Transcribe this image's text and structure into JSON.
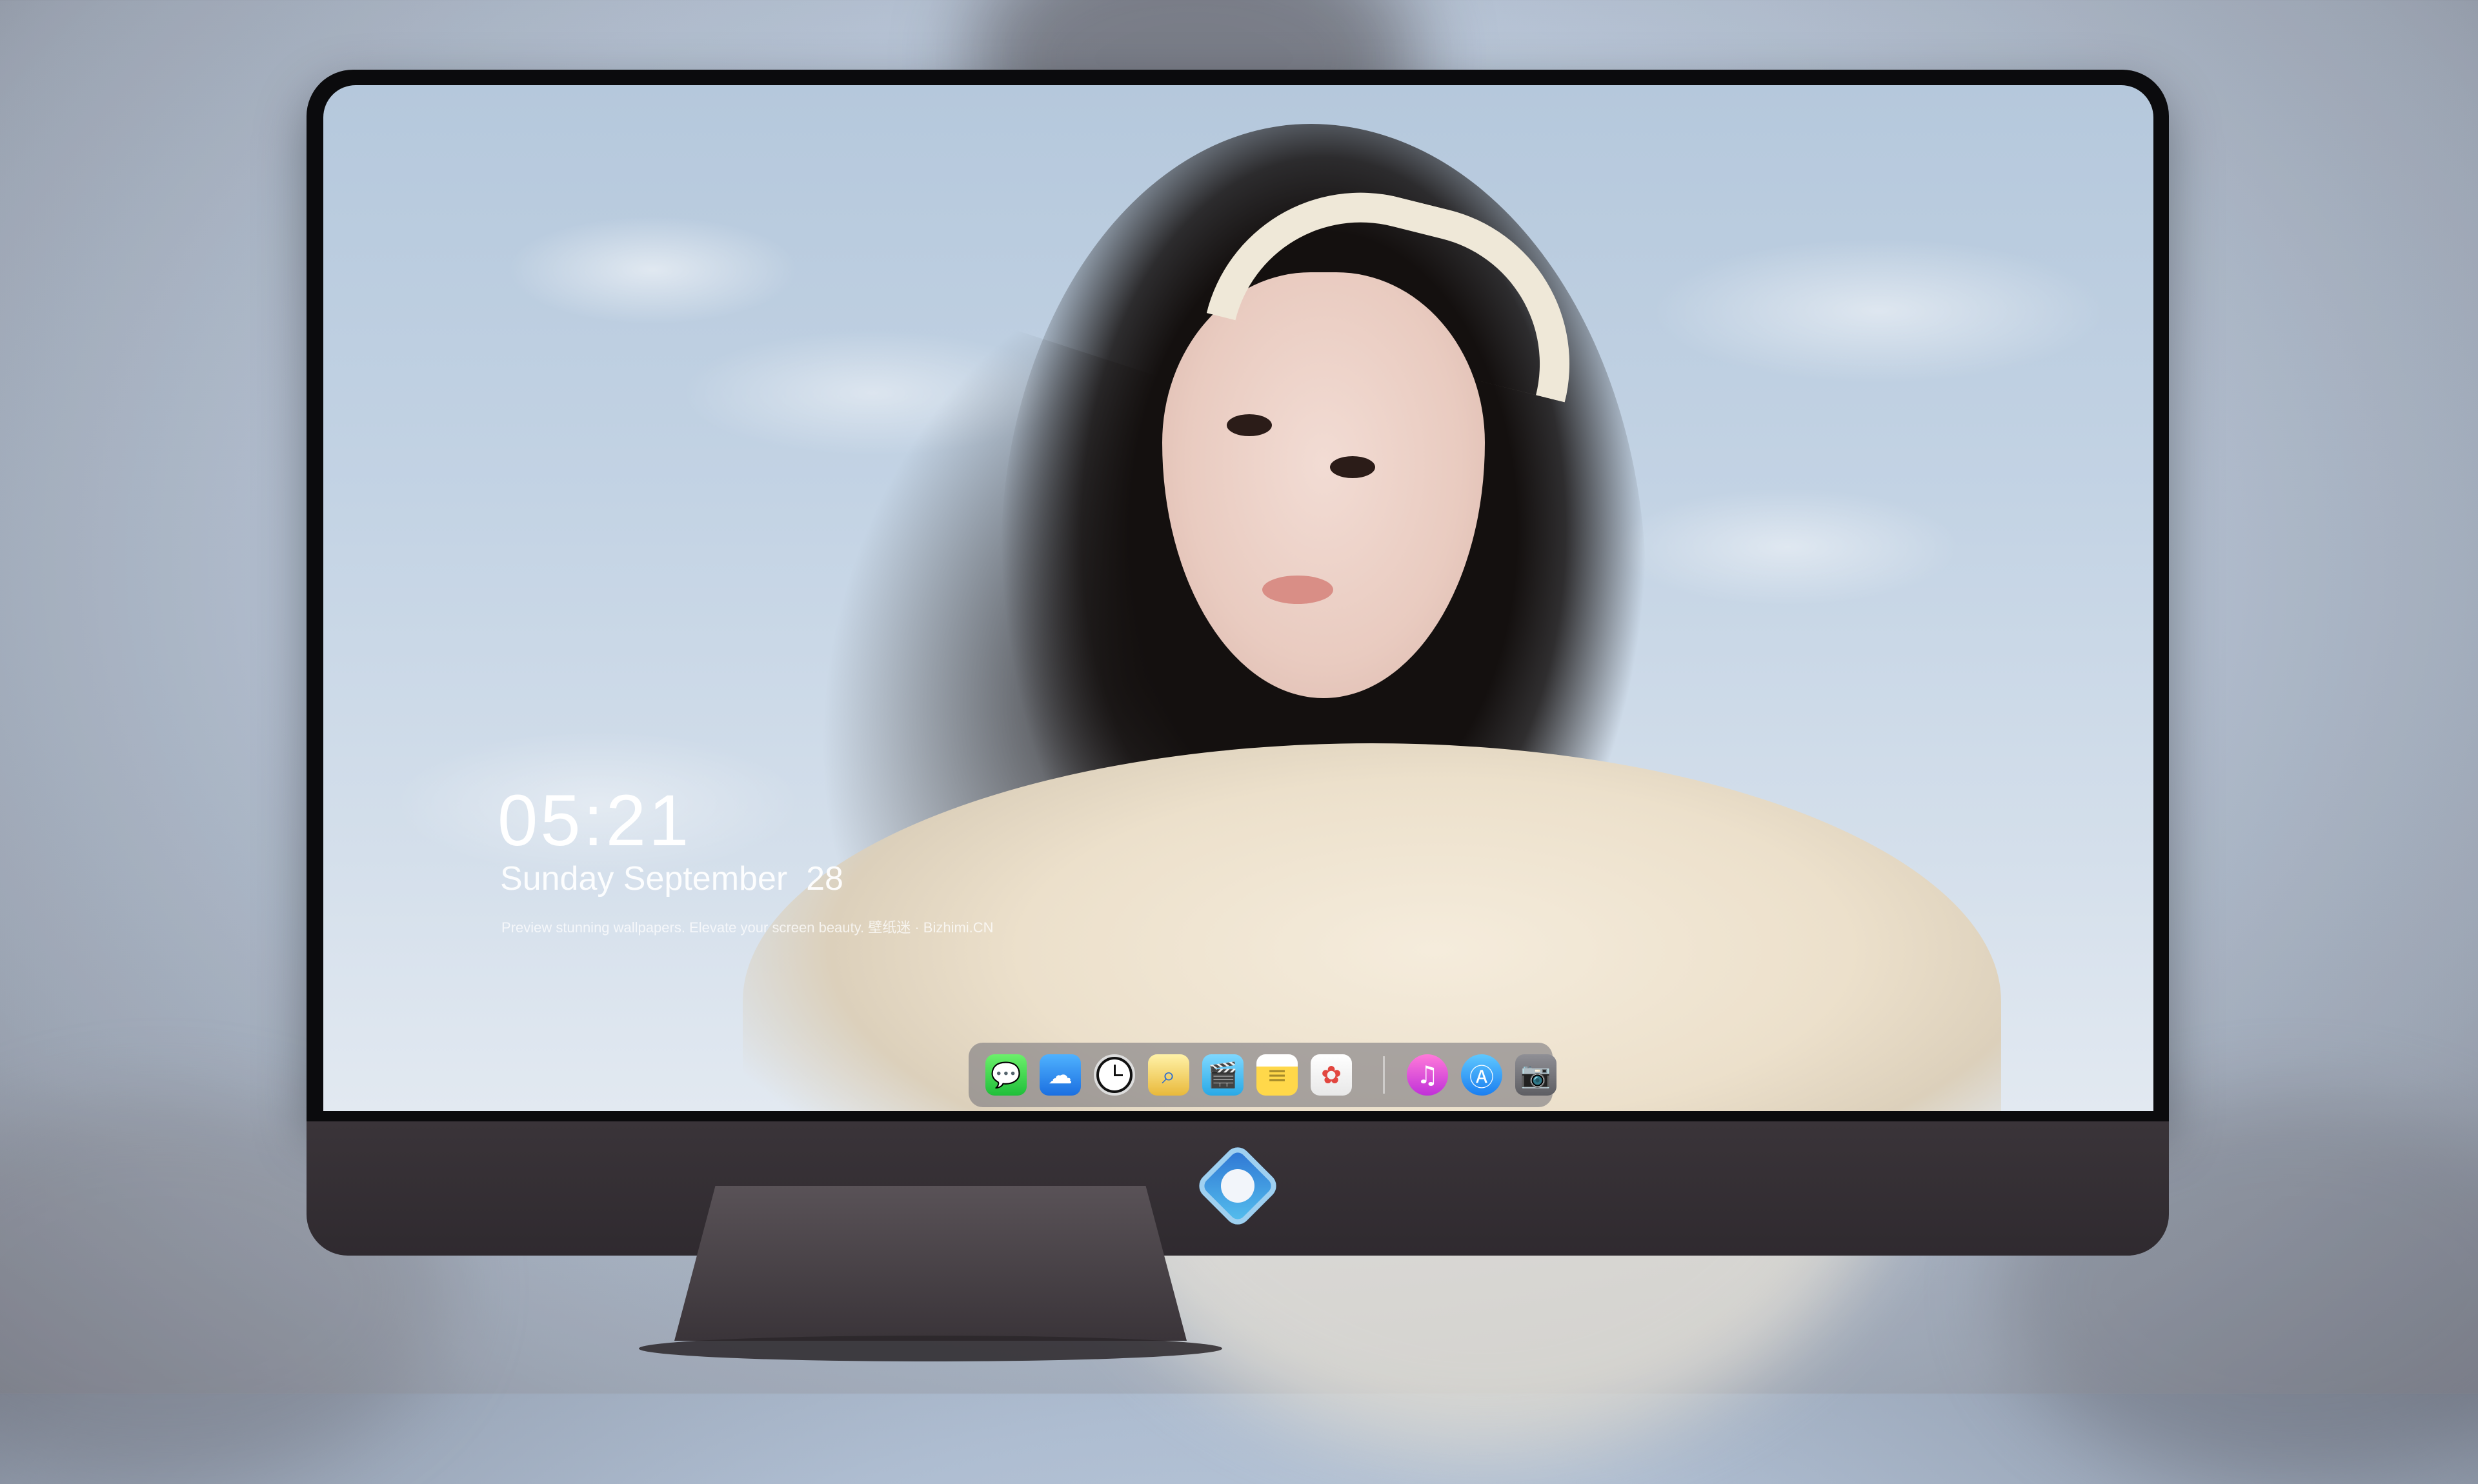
{
  "lockscreen": {
    "time": "05:21",
    "date": "Sunday September  28",
    "tagline": "Preview stunning wallpapers. Elevate your screen beauty. 壁纸迷 · Bizhimi.CN"
  },
  "dock": {
    "apps": [
      {
        "name": "Messages",
        "icon": "messages-icon"
      },
      {
        "name": "Weather",
        "icon": "weather-icon"
      },
      {
        "name": "Clock",
        "icon": "clock-icon"
      },
      {
        "name": "Preview",
        "icon": "preview-icon"
      },
      {
        "name": "Clips",
        "icon": "clips-icon"
      },
      {
        "name": "Notes",
        "icon": "notes-icon"
      },
      {
        "name": "Photos",
        "icon": "photos-icon"
      },
      {
        "name": "Music",
        "icon": "music-icon"
      },
      {
        "name": "App Store",
        "icon": "app-store-icon"
      },
      {
        "name": "Camera",
        "icon": "camera-icon"
      }
    ]
  },
  "colors": {
    "bezel": "#0b0b0d",
    "chin": "#3a3439",
    "dock_bg": "rgba(110,110,118,0.55)"
  }
}
